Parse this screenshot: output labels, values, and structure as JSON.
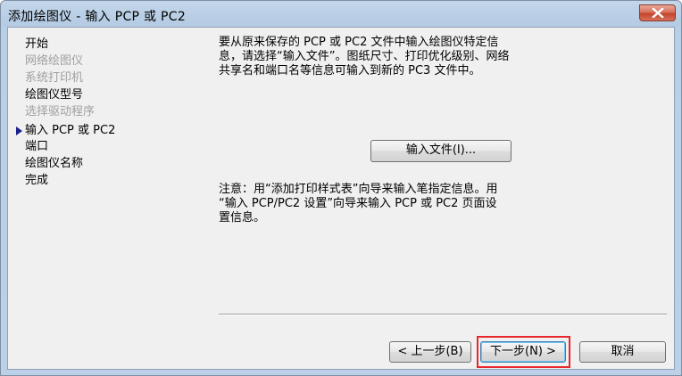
{
  "window": {
    "title": "添加绘图仪 - 输入 PCP 或 PC2",
    "close_icon": "close-icon"
  },
  "steps": [
    {
      "label": "开始",
      "enabled": true,
      "current": false
    },
    {
      "label": "网络绘图仪",
      "enabled": false,
      "current": false
    },
    {
      "label": "系统打印机",
      "enabled": false,
      "current": false
    },
    {
      "label": "绘图仪型号",
      "enabled": true,
      "current": false
    },
    {
      "label": "选择驱动程序",
      "enabled": false,
      "current": false
    },
    {
      "label": "输入 PCP 或 PC2",
      "enabled": true,
      "current": true
    },
    {
      "label": "端口",
      "enabled": true,
      "current": false
    },
    {
      "label": "绘图仪名称",
      "enabled": true,
      "current": false
    },
    {
      "label": "完成",
      "enabled": true,
      "current": false
    }
  ],
  "content": {
    "description_lines": [
      "要从原来保存的 PCP 或 PC2 文件中输入绘图仪特定信",
      "息，请选择“输入文件”。图纸尺寸、打印优化级别、网络",
      "共享名和端口名等信息可输入到新的 PC3 文件中。"
    ],
    "import_button": "输入文件(I)...",
    "note_lines": [
      "注意：用“添加打印样式表”向导来输入笔指定信息。用",
      "“输入 PCP/PC2 设置”向导来输入 PCP 或 PC2 页面设",
      "置信息。"
    ]
  },
  "footer": {
    "back_button": "< 上一步(B)",
    "next_button": "下一步(N) >",
    "cancel_button": "取消"
  }
}
